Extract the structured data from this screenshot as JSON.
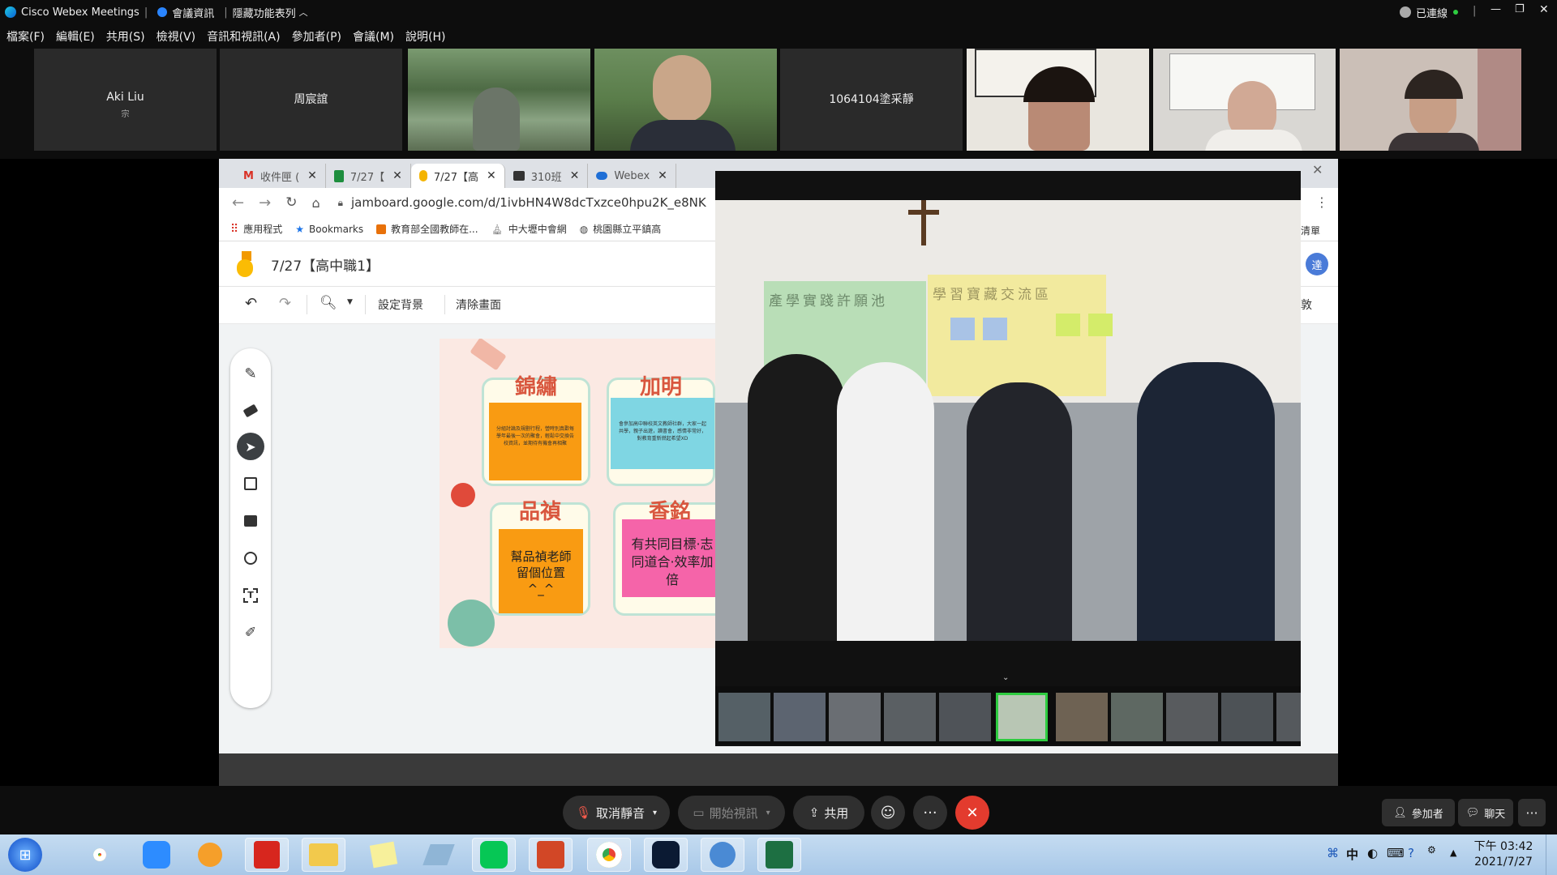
{
  "titlebar": {
    "app_title": "Cisco Webex Meetings",
    "meeting_info": "會議資訊",
    "hide_menu": "隱藏功能表列",
    "connected": "已連線"
  },
  "menu": [
    "檔案(F)",
    "編輯(E)",
    "共用(S)",
    "檢視(V)",
    "音訊和視訊(A)",
    "參加者(P)",
    "會議(M)",
    "說明(H)"
  ],
  "participants": [
    {
      "name": "Aki Liu",
      "sub": "宗"
    },
    {
      "name": "周宸誼",
      "sub": ""
    },
    {
      "name": "",
      "sub": ""
    },
    {
      "name": "",
      "sub": ""
    },
    {
      "name": "1064104塗采靜",
      "sub": ""
    },
    {
      "name": "",
      "sub": ""
    },
    {
      "name": "",
      "sub": ""
    },
    {
      "name": "",
      "sub": ""
    }
  ],
  "browser": {
    "tabs": [
      "收件匣 (",
      "7/27【",
      "7/27【高",
      "310班",
      "Webex"
    ],
    "url": "jamboard.google.com/d/1ivbHN4W8dcTxzce0hpu2K_e8NK",
    "bookmarks": [
      "應用程式",
      "Bookmarks",
      "教育部全國教師在...",
      "中大壢中會網",
      "桃園縣立平鎮高"
    ],
    "right_label": "清單"
  },
  "jamboard": {
    "title": "7/27【高中職1】",
    "bg_button": "設定背景",
    "clear_button": "清除畫面",
    "share_initial": "達",
    "right_cut": "敦"
  },
  "board": {
    "cards": [
      {
        "name": "錦繡",
        "note": "分組討論及規劃行程，營時別真歡每學年最後一次的聚會，輕鬆中交換告校資訊，並期待有機會再相聚"
      },
      {
        "name": "加明",
        "note": "會參加高中聯校英文教師社群，大家一起共學，親子出遊，讀書會，感情非常好，對教育重新燃起希望XD"
      },
      {
        "name": "品禎",
        "note": "幫品禎老師留個位置^_^"
      },
      {
        "name": "香銘",
        "note": "有共同目標·志同道合·效率加倍"
      }
    ]
  },
  "photo": {
    "poster_left": "產學實踐許願池",
    "poster_right": "學習寶藏交流區"
  },
  "controls": {
    "mute": "取消靜音",
    "video": "開始視訊",
    "share": "共用",
    "participants": "參加者",
    "chat": "聊天"
  },
  "taskbar": {
    "time": "下午 03:42",
    "date": "2021/7/27",
    "ime": "中"
  }
}
